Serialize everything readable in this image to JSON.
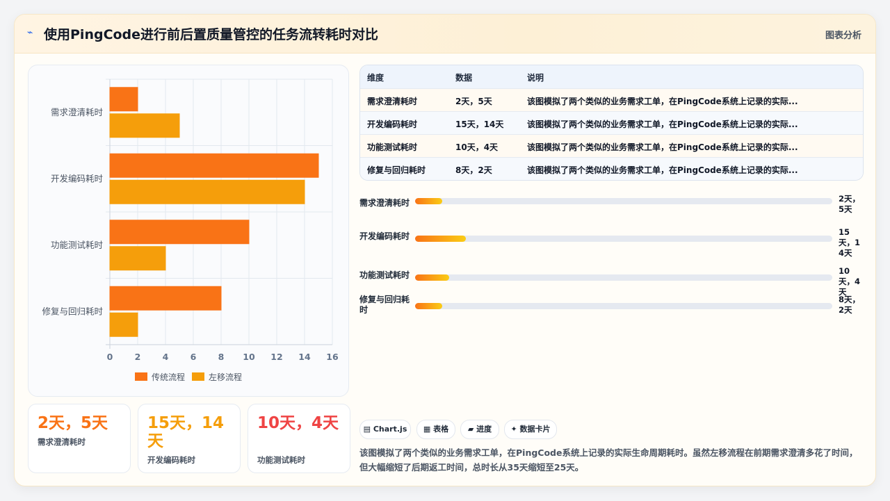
{
  "header": {
    "logo": "⌁",
    "title": "使用PingCode进行前后置质量管控的任务流转耗时对比",
    "tag": "图表分析"
  },
  "chart_data": {
    "type": "bar",
    "orientation": "horizontal",
    "categories": [
      "需求澄清耗时",
      "开发编码耗时",
      "功能测试耗时",
      "修复与回归耗时"
    ],
    "series": [
      {
        "name": "传统流程",
        "values": [
          2,
          15,
          10,
          8
        ],
        "color": "#f97316"
      },
      {
        "name": "左移流程",
        "values": [
          5,
          14,
          4,
          2
        ],
        "color": "#f59e0b"
      }
    ],
    "xlim": [
      0,
      16
    ],
    "xticks": [
      0,
      2,
      4,
      6,
      8,
      10,
      12,
      14,
      16
    ],
    "grid": true,
    "legend": "bottom"
  },
  "stats": [
    {
      "value": "2天，5天",
      "label": "需求澄清耗时",
      "color": "#f97316"
    },
    {
      "value": "15天，14天",
      "label": "开发编码耗时",
      "color": "#f59e0b"
    },
    {
      "value": "10天，4天",
      "label": "功能测试耗时",
      "color": "#ef4444"
    }
  ],
  "table": {
    "headers": [
      "维度",
      "数据",
      "说明"
    ],
    "rows": [
      [
        "需求澄清耗时",
        "2天，5天",
        "该图模拟了两个类似的业务需求工单，在PingCode系统上记录的实际..."
      ],
      [
        "开发编码耗时",
        "15天，14天",
        "该图模拟了两个类似的业务需求工单，在PingCode系统上记录的实际..."
      ],
      [
        "功能测试耗时",
        "10天，4天",
        "该图模拟了两个类似的业务需求工单，在PingCode系统上记录的实际..."
      ],
      [
        "修复与回归耗时",
        "8天，2天",
        "该图模拟了两个类似的业务需求工单，在PingCode系统上记录的实际..."
      ]
    ]
  },
  "progress": [
    {
      "label": "需求澄清耗时",
      "value": "2天，5天",
      "fraction": 0.065
    },
    {
      "label": "开发编码耗时",
      "value": "15天，14天",
      "fraction": 0.122
    },
    {
      "label": "功能测试耗时",
      "value": "10天，4天",
      "fraction": 0.082
    },
    {
      "label": "修复与回归耗时",
      "value": "8天，2天",
      "fraction": 0.065
    }
  ],
  "tabs": [
    {
      "icon": "▤",
      "label": "Chart.js"
    },
    {
      "icon": "▦",
      "label": "表格"
    },
    {
      "icon": "▰",
      "label": "进度"
    },
    {
      "icon": "✦",
      "label": "数据卡片"
    }
  ],
  "description": "该图模拟了两个类似的业务需求工单，在PingCode系统上记录的实际生命周期耗时。虽然左移流程在前期需求澄清多花了时间，但大幅缩短了后期返工时间，总时长从35天缩短至25天。"
}
